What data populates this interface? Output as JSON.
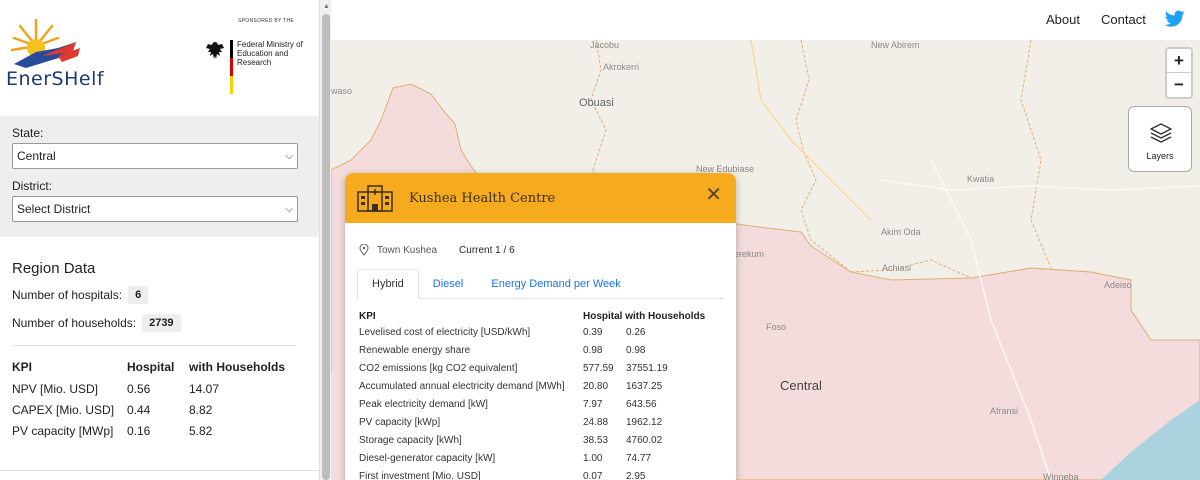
{
  "logos": {
    "brand_name": "EnerSHelf",
    "sponsor_label": "SPONSORED BY THE",
    "ministry_name": "Federal Ministry of Education and Research"
  },
  "filters": {
    "state_label": "State:",
    "state_value": "Central",
    "district_label": "District:",
    "district_value": "Select District"
  },
  "region": {
    "title": "Region Data",
    "hospitals_label": "Number of hospitals:",
    "hospitals_value": "6",
    "households_label": "Number of households:",
    "households_value": "2739",
    "kpi_headers": [
      "KPI",
      "Hospital",
      "with Households"
    ],
    "kpi_rows": [
      [
        "NPV [Mio. USD]",
        "0.56",
        "14.07"
      ],
      [
        "CAPEX [Mio. USD]",
        "0.44",
        "8.82"
      ],
      [
        "PV capacity [MWp]",
        "0.16",
        "5.82"
      ]
    ]
  },
  "topnav": {
    "about": "About",
    "contact": "Contact",
    "twitter_icon": "twitter-icon",
    "twitter_color": "#1da1f2"
  },
  "map": {
    "land_color": "#f2efe9",
    "region_color": "#f3dcdb",
    "border_color": "#e0b070",
    "water_color": "#aad3df",
    "places": [
      "Jacobu",
      "New Abirem",
      "Akrokerri",
      "Obuasi",
      "waso",
      "New Edubiase",
      "Kwatia",
      "Akim Oda",
      "Achiasi",
      "erekum",
      "Adeiso",
      "Foso",
      "Central",
      "Afransi",
      "Winneba"
    ],
    "zoom_in": "+",
    "zoom_out": "−",
    "layers_label": "Layers"
  },
  "popup": {
    "accent_color": "#f6ab1f",
    "title": "Kushea Health Centre",
    "town": "Town Kushea",
    "current": "Current 1 / 6",
    "close": "✕",
    "tabs": [
      "Hybrid",
      "Diesel",
      "Energy Demand per Week"
    ],
    "active_tab": "Hybrid",
    "headers": [
      "KPI",
      "Hospital with Households"
    ],
    "rows": [
      [
        "Levelised cost of electricity [USD/kWh]",
        "0.39",
        "0.26"
      ],
      [
        "Renewable energy share",
        "0.98",
        "0.98"
      ],
      [
        "CO2 emissions [kg CO2 equivalent]",
        "577.59",
        "37551.19"
      ],
      [
        "Accumulated annual electricity demand [MWh]",
        "20.80",
        "1637.25"
      ],
      [
        "Peak electricity demand [kW]",
        "7.97",
        "643.56"
      ],
      [
        "PV capacity [kWp]",
        "24.88",
        "1962.12"
      ],
      [
        "Storage capacity [kWh]",
        "38.53",
        "4760.02"
      ],
      [
        "Diesel-generator capacity [kW]",
        "1.00",
        "74.77"
      ],
      [
        "First investment [Mio. USD]",
        "0.07",
        "2.95"
      ]
    ]
  }
}
